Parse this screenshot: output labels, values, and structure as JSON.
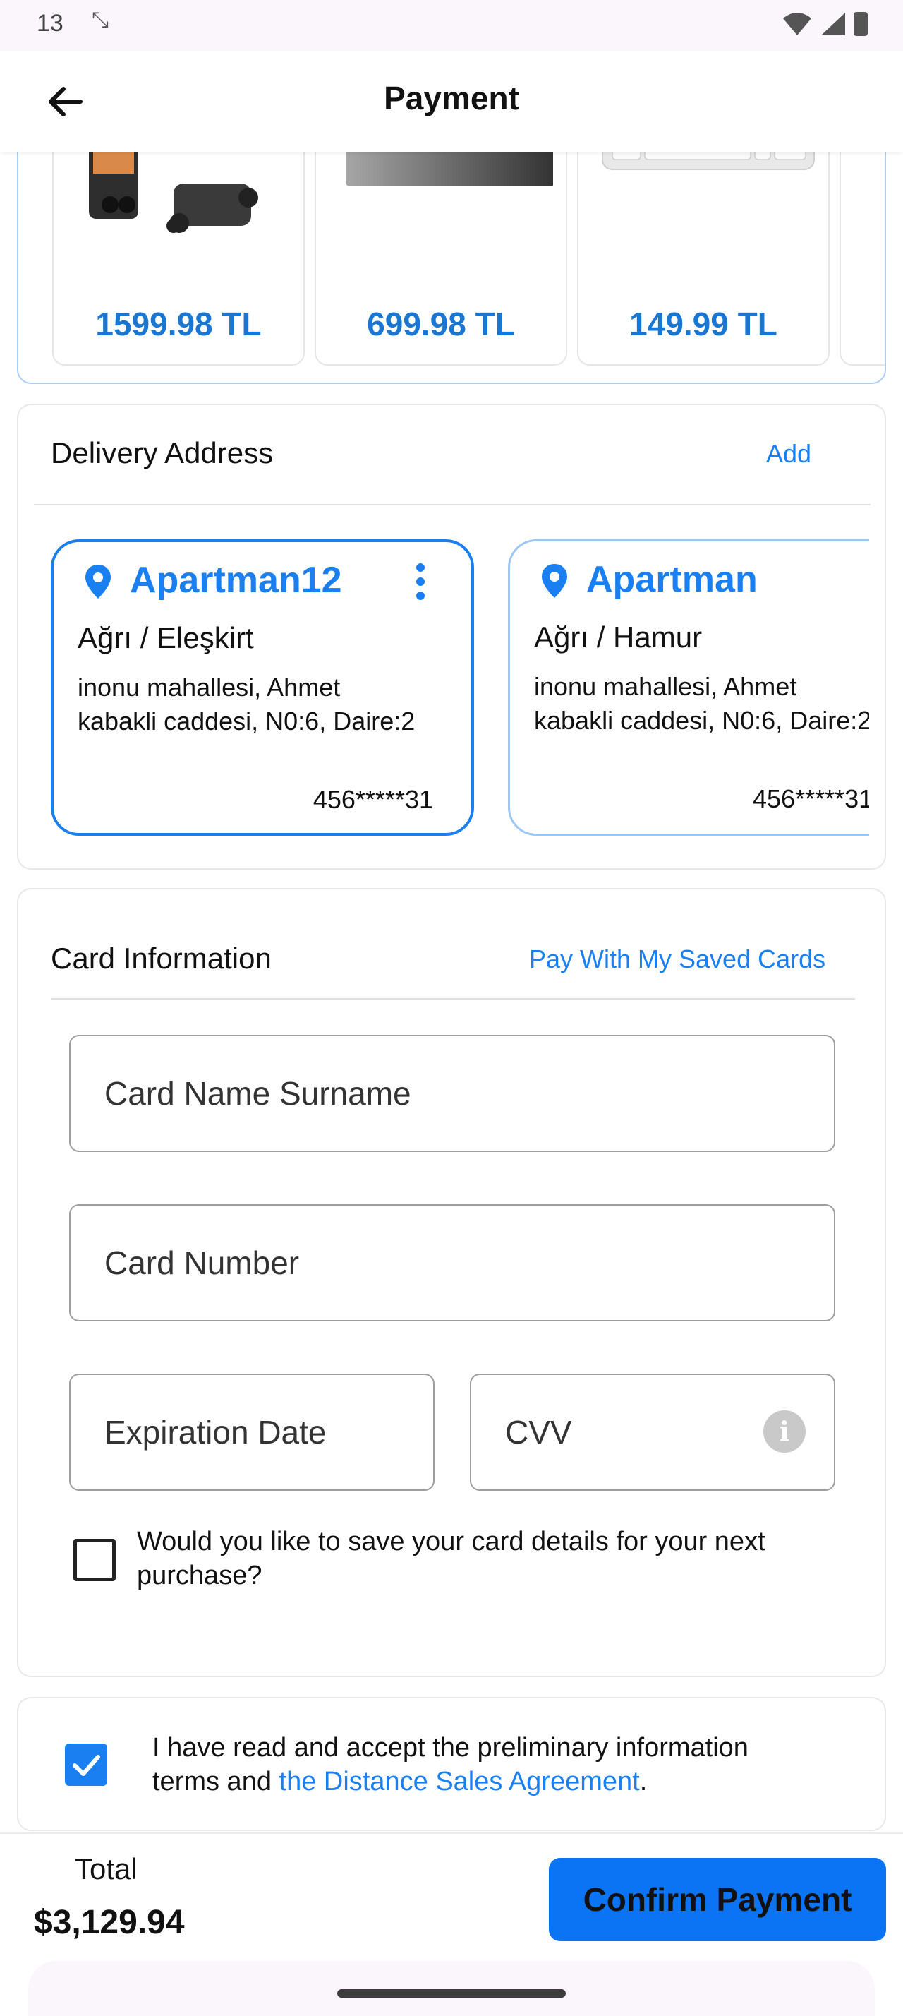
{
  "status_bar": {
    "time": "13",
    "sync_icon": "sync-icon"
  },
  "header": {
    "title": "Payment"
  },
  "products": [
    {
      "price": "1599.98 TL",
      "icon": "drone-image"
    },
    {
      "price": "699.98 TL",
      "icon": "tablet-image"
    },
    {
      "price": "149.99 TL",
      "icon": "keyboard-image"
    }
  ],
  "delivery": {
    "title": "Delivery Address",
    "add_label": "Add",
    "addresses": [
      {
        "name": "Apartman12",
        "city": "Ağrı / Eleşkirt",
        "line1": "inonu mahallesi, Ahmet",
        "line2": "kabakli caddesi, N0:6, Daire:2",
        "phone": "456*****31"
      },
      {
        "name": "Apartman",
        "city": "Ağrı / Hamur",
        "line1": "inonu mahallesi, Ahmet",
        "line2": "kabakli caddesi, N0:6, Daire:2",
        "phone": "456*****31"
      }
    ]
  },
  "card_info": {
    "title": "Card Information",
    "saved_cards_label": "Pay With My Saved Cards",
    "name_placeholder": "Card Name Surname",
    "number_placeholder": "Card Number",
    "expiry_placeholder": "Expiration Date",
    "cvv_placeholder": "CVV",
    "save_card_line1": "Would you like to save your card details for your next",
    "save_card_line2": "purchase?",
    "save_card_checked": false
  },
  "agreement": {
    "line1": "I have read and accept the preliminary information",
    "line2_prefix": "terms and ",
    "link": "the Distance Sales Agreement",
    "line2_suffix": ".",
    "checked": true
  },
  "footer": {
    "total_label": "Total",
    "total_value": "$3,129.94",
    "confirm_label": "Confirm Payment"
  },
  "colors": {
    "accent": "#1a7ff0",
    "price": "#1976d2",
    "button": "#0a74f5"
  }
}
